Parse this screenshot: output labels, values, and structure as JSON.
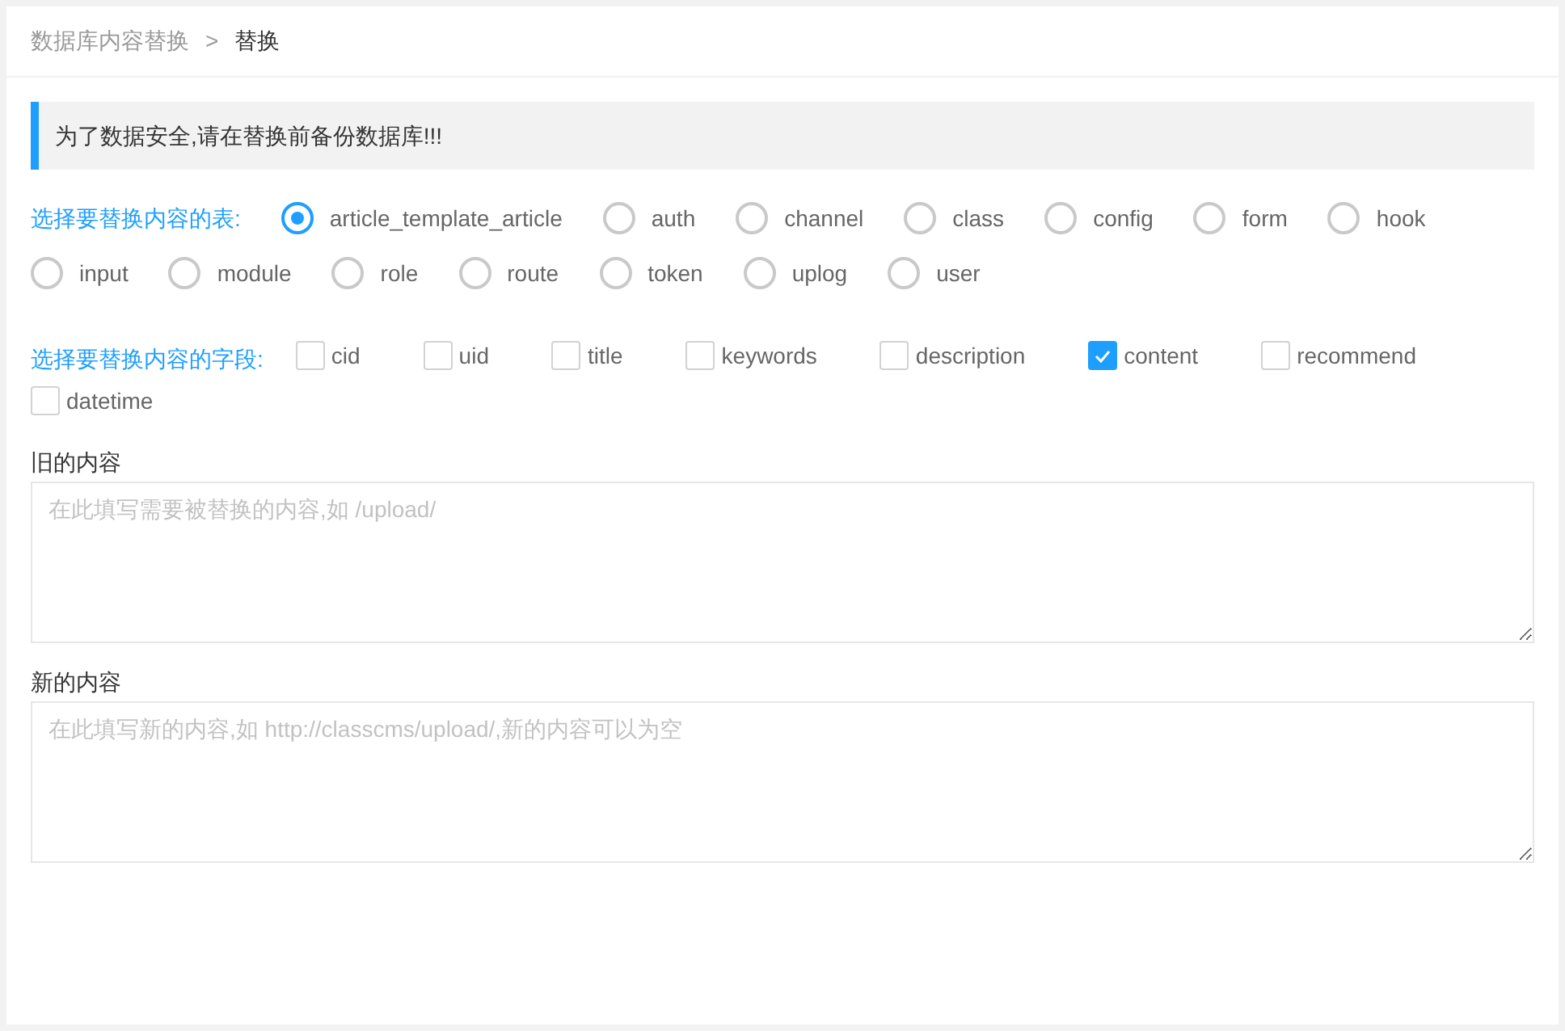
{
  "breadcrumb": [
    {
      "label": "数据库内容替换",
      "current": false
    },
    {
      "label": "替换",
      "current": true
    }
  ],
  "breadcrumb_separator": ">",
  "notice": "为了数据安全,请在替换前备份数据库!!!",
  "tables": {
    "label": "选择要替换内容的表:",
    "options": [
      {
        "label": "article_template_article",
        "selected": true
      },
      {
        "label": "auth",
        "selected": false
      },
      {
        "label": "channel",
        "selected": false
      },
      {
        "label": "class",
        "selected": false
      },
      {
        "label": "config",
        "selected": false
      },
      {
        "label": "form",
        "selected": false
      },
      {
        "label": "hook",
        "selected": false
      },
      {
        "label": "input",
        "selected": false
      },
      {
        "label": "module",
        "selected": false
      },
      {
        "label": "role",
        "selected": false
      },
      {
        "label": "route",
        "selected": false
      },
      {
        "label": "token",
        "selected": false
      },
      {
        "label": "uplog",
        "selected": false
      },
      {
        "label": "user",
        "selected": false
      }
    ]
  },
  "fields": {
    "label": "选择要替换内容的字段:",
    "options": [
      {
        "label": "cid",
        "checked": false
      },
      {
        "label": "uid",
        "checked": false
      },
      {
        "label": "title",
        "checked": false
      },
      {
        "label": "keywords",
        "checked": false
      },
      {
        "label": "description",
        "checked": false
      },
      {
        "label": "content",
        "checked": true
      },
      {
        "label": "recommend",
        "checked": false
      },
      {
        "label": "datetime",
        "checked": false
      }
    ]
  },
  "old_content": {
    "label": "旧的内容",
    "placeholder": "在此填写需要被替换的内容,如 /upload/"
  },
  "new_content": {
    "label": "新的内容",
    "placeholder": "在此填写新的内容,如 http://classcms/upload/,新的内容可以为空"
  }
}
